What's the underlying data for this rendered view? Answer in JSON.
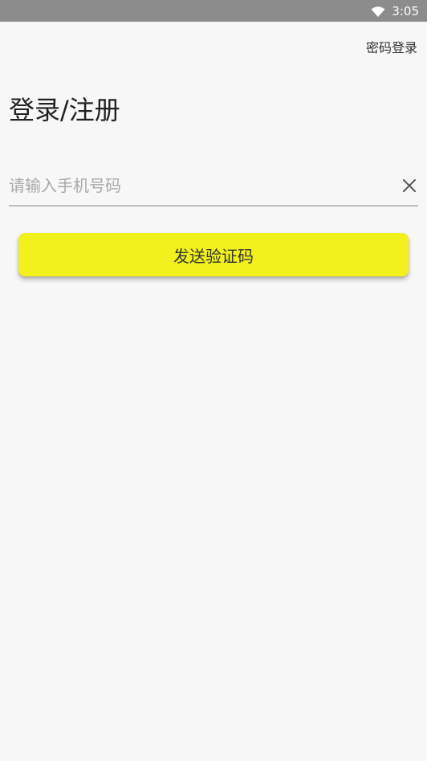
{
  "status_bar": {
    "time": "3:05",
    "wifi_icon": "wifi-icon"
  },
  "header": {
    "password_login_label": "密码登录"
  },
  "page": {
    "title": "登录/注册"
  },
  "phone_input": {
    "placeholder": "请输入手机号码",
    "value": "",
    "clear_icon": "close-icon"
  },
  "actions": {
    "send_code_label": "发送验证码"
  },
  "colors": {
    "status_bar_bg": "#8c8c8c",
    "page_bg": "#f7f7f7",
    "accent_button": "#f2f11d"
  }
}
